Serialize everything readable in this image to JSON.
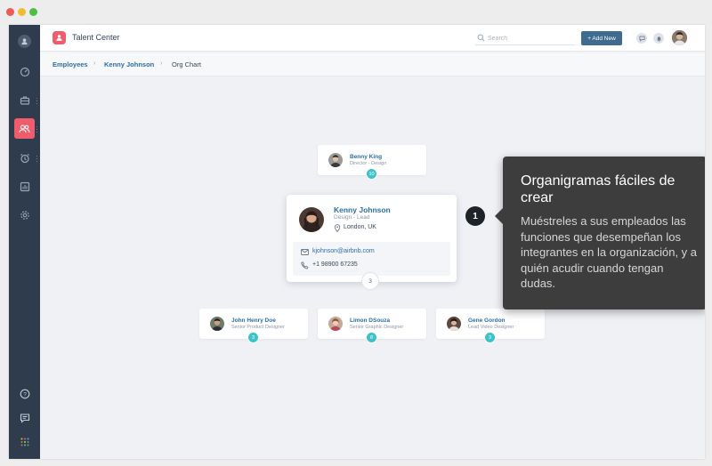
{
  "app": {
    "title": "Talent Center",
    "search_placeholder": "Search",
    "add_new_label": "+ Add New"
  },
  "sidebar": {
    "items": [
      {
        "icon": "user-icon"
      },
      {
        "icon": "dashboard-icon"
      },
      {
        "icon": "briefcase-icon"
      },
      {
        "icon": "people-icon",
        "active": true
      },
      {
        "icon": "alarm-icon"
      },
      {
        "icon": "report-icon"
      },
      {
        "icon": "settings-icon"
      },
      {
        "icon": "help-icon"
      },
      {
        "icon": "chat-icon"
      },
      {
        "icon": "apps-grid-icon"
      }
    ],
    "active_color": "#ef5d6d"
  },
  "breadcrumb": {
    "employees": "Employees",
    "person": "Kenny Johnson",
    "current": "Org Chart"
  },
  "org": {
    "manager": {
      "name": "Benny King",
      "role": "Director - Design",
      "count": "10"
    },
    "focus": {
      "name": "Kenny Johnson",
      "role": "Design - Lead",
      "location": "London, UK",
      "email": "kjohnson@airbnb.com",
      "phone": "+1 98900 67235",
      "count": "3"
    },
    "reports": [
      {
        "name": "John Henry Doe",
        "role": "Senior Product Designer",
        "count": "3"
      },
      {
        "name": "Limon DSouza",
        "role": "Senior Graphic Designer",
        "count": "8"
      },
      {
        "name": "Gene Gordon",
        "role": "Lead Video Designer",
        "count": "3"
      }
    ]
  },
  "callout": {
    "number": "1",
    "title": "Organigramas fáciles de crear",
    "body": "Muéstreles a sus empleados las funciones que desempeñan los integrantes en la organización, y a quién acudir cuando tengan dudas."
  },
  "colors": {
    "accent": "#2c6ea3",
    "count_badge": "#3cc2c8",
    "sidebar_bg": "#2e3c4d",
    "button": "#3e6b8f"
  }
}
